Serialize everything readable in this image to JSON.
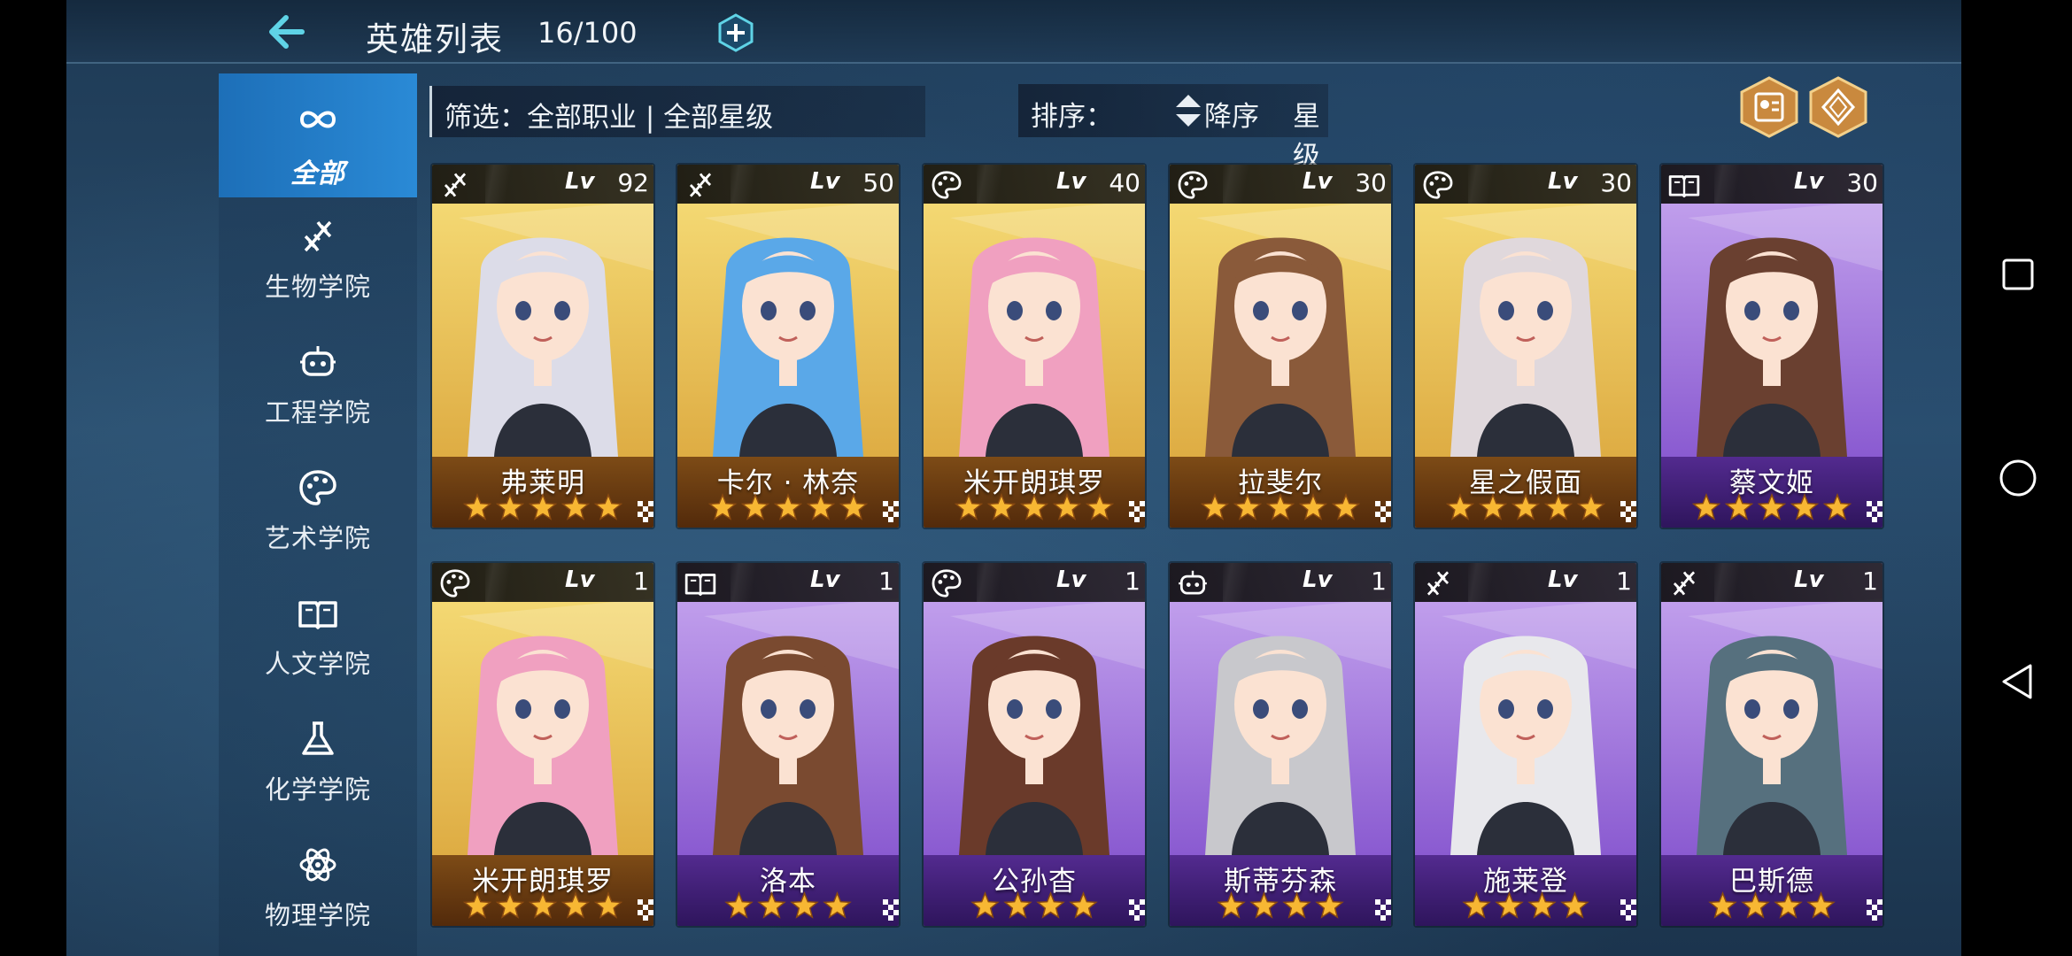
{
  "header": {
    "title": "英雄列表",
    "count": "16/100"
  },
  "sidebar": {
    "items": [
      {
        "label": "全部",
        "icon": "infinity-icon",
        "active": true
      },
      {
        "label": "生物学院",
        "icon": "dna-icon",
        "active": false
      },
      {
        "label": "工程学院",
        "icon": "robot-icon",
        "active": false
      },
      {
        "label": "艺术学院",
        "icon": "palette-icon",
        "active": false
      },
      {
        "label": "人文学院",
        "icon": "book-icon",
        "active": false
      },
      {
        "label": "化学学院",
        "icon": "flask-icon",
        "active": false
      },
      {
        "label": "物理学院",
        "icon": "atom-icon",
        "active": false
      }
    ]
  },
  "filter": {
    "text": "筛选：全部职业 | 全部星级"
  },
  "sort": {
    "label": "排序：",
    "direction": "降序",
    "field": "星级"
  },
  "colors": {
    "accent": "#2a8ad6",
    "star": "#f7b733",
    "gold_rarity": "#f2c14e",
    "purple_rarity": "#7b48c9",
    "teal": "#5fd3e6"
  },
  "heroes": [
    {
      "name": "弗莱明",
      "lv_tag": "Lv",
      "level": "92",
      "class_icon": "dna-icon",
      "stars": 5,
      "rarity": "gold",
      "hair": "#dcdce8"
    },
    {
      "name": "卡尔 · 林奈",
      "lv_tag": "Lv",
      "level": "50",
      "class_icon": "dna-icon",
      "stars": 5,
      "rarity": "gold",
      "hair": "#5aa8e8"
    },
    {
      "name": "米开朗琪罗",
      "lv_tag": "Lv",
      "level": "40",
      "class_icon": "palette-icon",
      "stars": 5,
      "rarity": "gold",
      "hair": "#f0a0c0"
    },
    {
      "name": "拉斐尔",
      "lv_tag": "Lv",
      "level": "30",
      "class_icon": "palette-icon",
      "stars": 5,
      "rarity": "gold",
      "hair": "#8a5a3a"
    },
    {
      "name": "星之假面",
      "lv_tag": "Lv",
      "level": "30",
      "class_icon": "palette-icon",
      "stars": 5,
      "rarity": "gold",
      "hair": "#e0d8dc"
    },
    {
      "name": "蔡文姬",
      "lv_tag": "Lv",
      "level": "30",
      "class_icon": "book-icon",
      "stars": 5,
      "rarity": "purple",
      "hair": "#6a4030"
    },
    {
      "name": "米开朗琪罗",
      "lv_tag": "Lv",
      "level": "1",
      "class_icon": "palette-icon",
      "stars": 5,
      "rarity": "gold",
      "hair": "#f0a0c0"
    },
    {
      "name": "洛本",
      "lv_tag": "Lv",
      "level": "1",
      "class_icon": "book-icon",
      "stars": 4,
      "rarity": "purple",
      "hair": "#7a4a30"
    },
    {
      "name": "公孙杳",
      "lv_tag": "Lv",
      "level": "1",
      "class_icon": "palette-icon",
      "stars": 4,
      "rarity": "purple",
      "hair": "#6a3a2a"
    },
    {
      "name": "斯蒂芬森",
      "lv_tag": "Lv",
      "level": "1",
      "class_icon": "robot-icon",
      "stars": 4,
      "rarity": "purple",
      "hair": "#c8c8cc"
    },
    {
      "name": "施莱登",
      "lv_tag": "Lv",
      "level": "1",
      "class_icon": "dna-icon",
      "stars": 4,
      "rarity": "purple",
      "hair": "#e8e8ec"
    },
    {
      "name": "巴斯德",
      "lv_tag": "Lv",
      "level": "1",
      "class_icon": "dna-icon",
      "stars": 4,
      "rarity": "purple",
      "hair": "#56707e"
    }
  ]
}
